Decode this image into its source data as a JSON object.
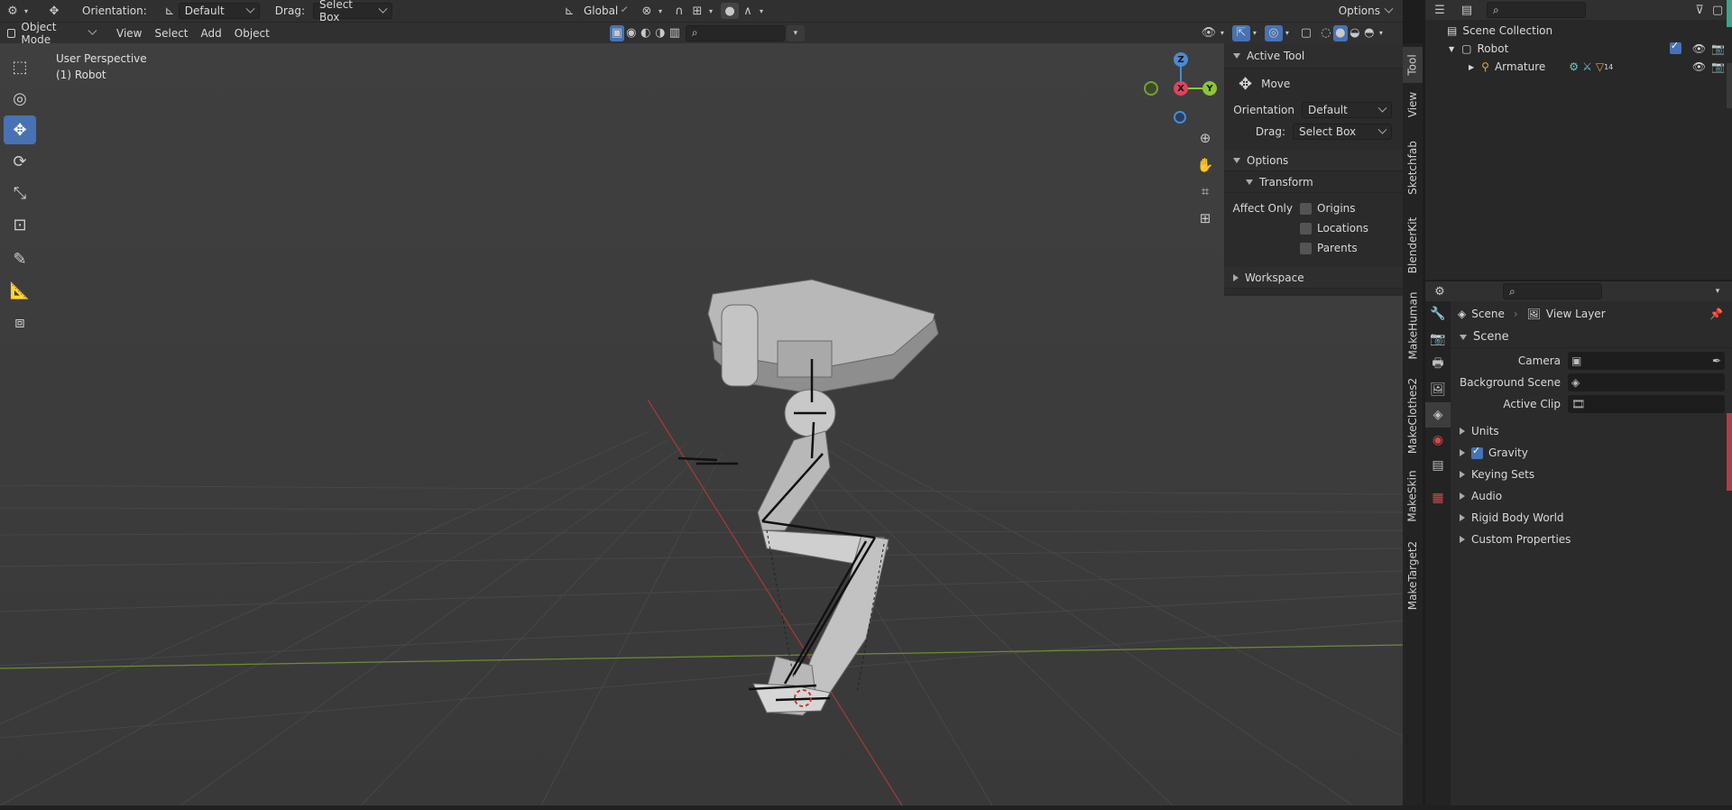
{
  "header": {
    "orientation_label": "Orientation:",
    "orientation_value": "Default",
    "drag_label": "Drag:",
    "drag_value": "Select Box",
    "transform_space": "Global",
    "options_label": "Options"
  },
  "header2": {
    "mode": "Object Mode",
    "menu": [
      "View",
      "Select",
      "Add",
      "Object"
    ]
  },
  "viewport": {
    "perspective_label": "User Perspective",
    "object_label": "(1) Robot",
    "gizmo": {
      "z": "Z",
      "x": "X",
      "y": "Y"
    }
  },
  "npanel": {
    "active_tool_title": "Active Tool",
    "tool_name": "Move",
    "orientation_label": "Orientation",
    "orientation_value": "Default",
    "drag_label": "Drag:",
    "drag_value": "Select Box",
    "options_title": "Options",
    "transform_title": "Transform",
    "affect_only_label": "Affect Only",
    "checkboxes": [
      "Origins",
      "Locations",
      "Parents"
    ],
    "workspace_title": "Workspace"
  },
  "vtabs": [
    "Tool",
    "View",
    "Sketchfab",
    "BlenderKit",
    "MakeHuman",
    "MakeClothes2",
    "MakeSkin",
    "MakeTarget2"
  ],
  "outliner": {
    "scene_collection": "Scene Collection",
    "robot": "Robot",
    "armature": "Armature",
    "armature_count": "14"
  },
  "properties": {
    "breadcrumb_scene": "Scene",
    "breadcrumb_layer": "View Layer",
    "section": "Scene",
    "camera_label": "Camera",
    "bg_scene_label": "Background Scene",
    "active_clip_label": "Active Clip",
    "subpanels": [
      "Units",
      "Gravity",
      "Keying Sets",
      "Audio",
      "Rigid Body World",
      "Custom Properties"
    ]
  },
  "colors": {
    "accent": "#4772b3",
    "viewport_bg": "#3d3d3d",
    "x_axis": "#e0435a",
    "y_axis": "#8cc43b",
    "z_axis": "#4a8ad4"
  }
}
